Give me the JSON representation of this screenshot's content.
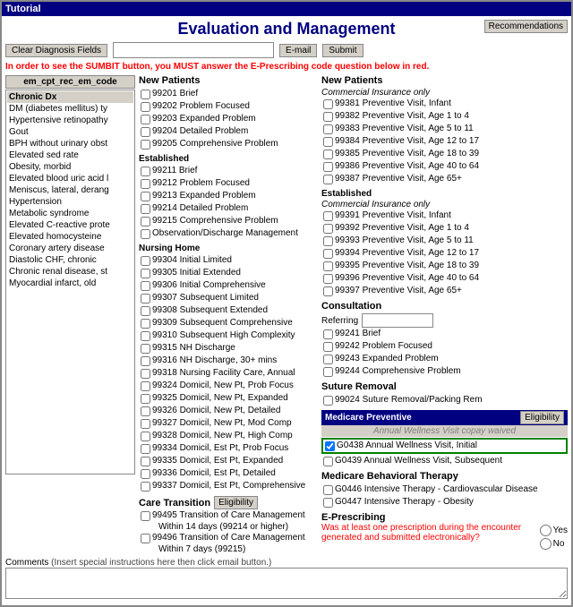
{
  "window": {
    "title": "Tutorial"
  },
  "header": {
    "title": "Evaluation and Management",
    "recommendations_label": "Recommendations"
  },
  "toolbar": {
    "clear_label": "Clear Diagnosis Fields",
    "email_label": "E-mail",
    "submit_label": "Submit"
  },
  "warning": "In order to see the SUMBIT button, you MUST answer the E-Prescribing code question below in red.",
  "chronic_dx": {
    "header": "Chronic Dx",
    "items": [
      "DM (diabetes mellitus) ty",
      "Hypertensive retinopathy",
      "Gout",
      "BPH without urinary obst",
      "Elevated sed rate",
      "Obesity, morbid",
      "Elevated blood uric acid l",
      "Meniscus, lateral, derang",
      "Hypertension",
      "Metabolic syndrome",
      "Elevated C-reactive prote",
      "Elevated homocysteine",
      "Coronary artery disease",
      "Diastolic CHF, chronic",
      "Chronic renal disease, st",
      "Myocardial infarct, old"
    ]
  },
  "new_patients": {
    "title": "New Patients",
    "items": [
      {
        "code": "99201",
        "label": "Brief"
      },
      {
        "code": "99202",
        "label": "Problem Focused"
      },
      {
        "code": "99203",
        "label": "Expanded Problem"
      },
      {
        "code": "99204",
        "label": "Detailed Problem"
      },
      {
        "code": "99205",
        "label": "Comprehensive Problem"
      }
    ],
    "established_title": "Established",
    "established": [
      {
        "code": "99211",
        "label": "Brief"
      },
      {
        "code": "99212",
        "label": "Problem Focused"
      },
      {
        "code": "99213",
        "label": "Expanded Problem"
      },
      {
        "code": "99214",
        "label": "Detailed Problem"
      },
      {
        "code": "99215",
        "label": "Comprehensive Problem"
      },
      {
        "code": "",
        "label": "Observation/Discharge Management"
      }
    ],
    "nursing_home_title": "Nursing Home",
    "nursing_home": [
      {
        "code": "99304",
        "label": "Initial Limited"
      },
      {
        "code": "99305",
        "label": "Initial Extended"
      },
      {
        "code": "99306",
        "label": "Initial Comprehensive"
      },
      {
        "code": "99307",
        "label": "Subsequent Limited"
      },
      {
        "code": "99308",
        "label": "Subsequent Extended"
      },
      {
        "code": "99309",
        "label": "Subsequent Comprehensive"
      },
      {
        "code": "99310",
        "label": "Subsequent High Complexity"
      },
      {
        "code": "99315",
        "label": "NH Discharge"
      },
      {
        "code": "99316",
        "label": "NH Discharge, 30+ mins"
      },
      {
        "code": "99318",
        "label": "Nursing Facility Care, Annual"
      },
      {
        "code": "99324",
        "label": "Domicil, New Pt, Prob Focus"
      },
      {
        "code": "99325",
        "label": "Domicil, New Pt, Expanded"
      },
      {
        "code": "99326",
        "label": "Domicil, New Pt, Detailed"
      },
      {
        "code": "99327",
        "label": "Domicil, New Pt, Mod Comp"
      },
      {
        "code": "99328",
        "label": "Domicil, New Pt, High Comp"
      },
      {
        "code": "99334",
        "label": "Domicil, Est Pt, Prob Focus"
      },
      {
        "code": "99335",
        "label": "Domicil, Est Pt, Expanded"
      },
      {
        "code": "99336",
        "label": "Domicil, Est Pt, Detailed"
      },
      {
        "code": "99337",
        "label": "Domicil, Est Pt, Comprehensive"
      }
    ]
  },
  "care_transition": {
    "title": "Care Transition",
    "eligibility_label": "Eligibility",
    "items": [
      {
        "code": "99495",
        "label": "Transition of Care Management",
        "sub": "Within 14 days (99214 or higher)"
      },
      {
        "code": "99496",
        "label": "Transition of Care Management",
        "sub": "Within 7 days (99215)"
      }
    ]
  },
  "new_patients_commercial": {
    "title": "New Patients",
    "subtitle": "Commercial Insurance only",
    "items": [
      {
        "code": "99381",
        "label": "Preventive Visit, Infant"
      },
      {
        "code": "99382",
        "label": "Preventive Visit, Age 1 to 4"
      },
      {
        "code": "99383",
        "label": "Preventive Visit, Age 5 to 11"
      },
      {
        "code": "99384",
        "label": "Preventive Visit, Age 12 to 17"
      },
      {
        "code": "99385",
        "label": "Preventive Visit, Age 18 to 39"
      },
      {
        "code": "99386",
        "label": "Preventive Visit, Age 40 to 64"
      },
      {
        "code": "99387",
        "label": "Preventive Visit, Age 65+"
      }
    ],
    "established_title": "Established",
    "established_subtitle": "Commercial Insurance only",
    "established": [
      {
        "code": "99391",
        "label": "Preventive Visit, Infant"
      },
      {
        "code": "99392",
        "label": "Preventive Visit, Age 1 to 4"
      },
      {
        "code": "99393",
        "label": "Preventive Visit, Age 5 to 11"
      },
      {
        "code": "99394",
        "label": "Preventive Visit, Age 12 to 17"
      },
      {
        "code": "99395",
        "label": "Preventive Visit, Age 18 to 39"
      },
      {
        "code": "99396",
        "label": "Preventive Visit, Age 40 to 64"
      },
      {
        "code": "99397",
        "label": "Preventive Visit, Age 65+"
      }
    ]
  },
  "consultation": {
    "title": "Consultation",
    "referring_label": "Referring",
    "items": [
      {
        "code": "99241",
        "label": "Brief"
      },
      {
        "code": "99242",
        "label": "Problem Focused"
      },
      {
        "code": "99243",
        "label": "Expanded Problem"
      },
      {
        "code": "99244",
        "label": "Comprehensive Problem"
      }
    ]
  },
  "suture": {
    "title": "Suture Removal",
    "item": {
      "code": "99024",
      "label": "Suture Removal/Packing Rem"
    }
  },
  "medicare_preventive": {
    "title": "Medicare Preventive",
    "eligibility_label": "Eligibility",
    "items": [
      {
        "code": "G0438",
        "label": "Annual Wellness Visit, Initial",
        "checked": true
      },
      {
        "code": "G0439",
        "label": "Annual Wellness Visit, Subsequent",
        "checked": false
      }
    ]
  },
  "medicare_behavioral": {
    "title": "Medicare Behavioral Therapy",
    "items": [
      {
        "code": "G0446",
        "label": "Intensive Therapy - Cardiovascular Disease"
      },
      {
        "code": "G0447",
        "label": "Intensive Therapy - Obesity"
      }
    ]
  },
  "eprescribing": {
    "title": "E-Prescribing",
    "question": "Was at least one prescription during the encounter generated and submitted electronically?",
    "yes_label": "Yes",
    "no_label": "No"
  },
  "comments": {
    "label": "Comments",
    "sublabel": "(Insert special instructions here then click email button.)"
  }
}
